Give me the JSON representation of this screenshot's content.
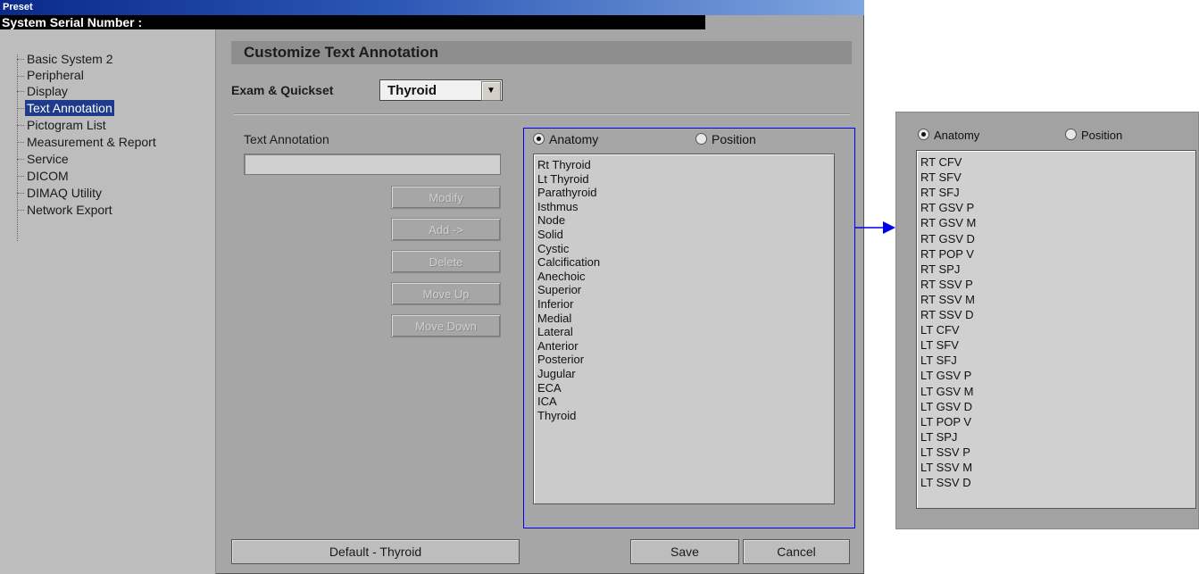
{
  "window": {
    "title": "Preset",
    "serial_label": "System Serial Number :"
  },
  "sidebar": {
    "items": [
      {
        "label": "Basic System 2"
      },
      {
        "label": "Peripheral"
      },
      {
        "label": "Display"
      },
      {
        "label": "Text Annotation",
        "selected": true
      },
      {
        "label": "Pictogram List"
      },
      {
        "label": "Measurement & Report"
      },
      {
        "label": "Service"
      },
      {
        "label": "DICOM"
      },
      {
        "label": "DIMAQ Utility"
      },
      {
        "label": "Network Export"
      }
    ]
  },
  "main": {
    "heading": "Customize Text Annotation",
    "exam_label": "Exam & Quickset",
    "exam_value": "Thyroid",
    "text_annotation_label": "Text Annotation",
    "text_annotation_value": "",
    "buttons": {
      "modify": "Modify",
      "add": "Add ->",
      "delete": "Delete",
      "move_up": "Move Up",
      "move_down": "Move Down"
    },
    "radio_anatomy": "Anatomy",
    "radio_position": "Position",
    "selected_radio": "Anatomy",
    "anatomy_list": [
      "Rt Thyroid",
      "Lt Thyroid",
      "Parathyroid",
      "Isthmus",
      "Node",
      "Solid",
      "Cystic",
      "Calcification",
      "Anechoic",
      "Superior",
      "Inferior",
      "Medial",
      "Lateral",
      "Anterior",
      "Posterior",
      "Jugular",
      "ECA",
      "ICA",
      "Thyroid"
    ],
    "default_button": "Default - Thyroid",
    "save_button": "Save",
    "cancel_button": "Cancel"
  },
  "callout": {
    "radio_anatomy": "Anatomy",
    "radio_position": "Position",
    "list": [
      "RT CFV",
      "RT SFV",
      "RT SFJ",
      "RT GSV P",
      "RT GSV M",
      "RT GSV D",
      "RT POP V",
      "RT SPJ",
      "RT SSV P",
      "RT SSV M",
      "RT SSV D",
      "LT CFV",
      "LT SFV",
      "LT SFJ",
      "LT GSV P",
      "LT GSV M",
      "LT GSV D",
      "LT POP V",
      "LT SPJ",
      "LT SSV P",
      "LT SSV M",
      "LT SSV D"
    ]
  },
  "colors": {
    "highlight": "#0000ee",
    "selection": "#1e3a8a"
  }
}
